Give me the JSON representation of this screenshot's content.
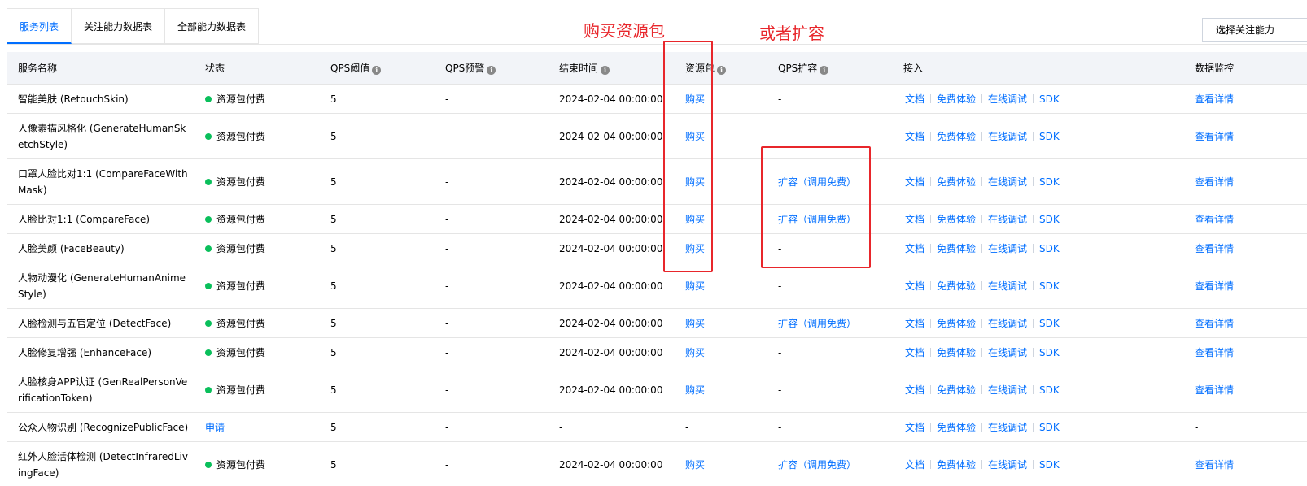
{
  "tabs": [
    {
      "label": "服务列表",
      "active": true
    },
    {
      "label": "关注能力数据表",
      "active": false
    },
    {
      "label": "全部能力数据表",
      "active": false
    }
  ],
  "select_button": "选择关注能力",
  "annotations": {
    "buy_package": "购买资源包",
    "or_expand": "或者扩容",
    "color": "#e8262b"
  },
  "colors": {
    "link": "#006eff",
    "status_green": "#0abf5b",
    "header_bg": "#f2f4f8"
  },
  "table": {
    "headers": {
      "name": "服务名称",
      "status": "状态",
      "qps_threshold": "QPS阈值",
      "qps_alert": "QPS预警",
      "end_time": "结束时间",
      "package": "资源包",
      "qps_expand": "QPS扩容",
      "access": "接入",
      "monitor": "数据监控"
    },
    "access_links": [
      "文档",
      "免费体验",
      "在线调试",
      "SDK"
    ],
    "rows": [
      {
        "name": "智能美肤 (RetouchSkin)",
        "status": "资源包付费",
        "qps": "5",
        "alert": "-",
        "end": "2024-02-04 00:00:00",
        "package": "购买",
        "expand": "-",
        "monitor": "查看详情"
      },
      {
        "name": "人像素描风格化 (GenerateHumanSketchStyle)",
        "status": "资源包付费",
        "qps": "5",
        "alert": "-",
        "end": "2024-02-04 00:00:00",
        "package": "购买",
        "expand": "-",
        "monitor": "查看详情"
      },
      {
        "name": "口罩人脸比对1:1 (CompareFaceWithMask)",
        "status": "资源包付费",
        "qps": "5",
        "alert": "-",
        "end": "2024-02-04 00:00:00",
        "package": "购买",
        "expand": "扩容（调用免费）",
        "monitor": "查看详情"
      },
      {
        "name": "人脸比对1:1 (CompareFace)",
        "status": "资源包付费",
        "qps": "5",
        "alert": "-",
        "end": "2024-02-04 00:00:00",
        "package": "购买",
        "expand": "扩容（调用免费）",
        "monitor": "查看详情"
      },
      {
        "name": "人脸美颜 (FaceBeauty)",
        "status": "资源包付费",
        "qps": "5",
        "alert": "-",
        "end": "2024-02-04 00:00:00",
        "package": "购买",
        "expand": "-",
        "monitor": "查看详情"
      },
      {
        "name": "人物动漫化 (GenerateHumanAnimeStyle)",
        "status": "资源包付费",
        "qps": "5",
        "alert": "-",
        "end": "2024-02-04 00:00:00",
        "package": "购买",
        "expand": "-",
        "monitor": "查看详情"
      },
      {
        "name": "人脸检测与五官定位 (DetectFace)",
        "status": "资源包付费",
        "qps": "5",
        "alert": "-",
        "end": "2024-02-04 00:00:00",
        "package": "购买",
        "expand": "扩容（调用免费）",
        "monitor": "查看详情"
      },
      {
        "name": "人脸修复增强 (EnhanceFace)",
        "status": "资源包付费",
        "qps": "5",
        "alert": "-",
        "end": "2024-02-04 00:00:00",
        "package": "购买",
        "expand": "-",
        "monitor": "查看详情"
      },
      {
        "name": "人脸核身APP认证 (GenRealPersonVerificationToken)",
        "status": "资源包付费",
        "qps": "5",
        "alert": "-",
        "end": "2024-02-04 00:00:00",
        "package": "购买",
        "expand": "-",
        "monitor": "查看详情"
      },
      {
        "name": "公众人物识别 (RecognizePublicFace)",
        "status": "申请",
        "qps": "5",
        "alert": "-",
        "end": "-",
        "package": "-",
        "expand": "-",
        "monitor": "-"
      },
      {
        "name": "红外人脸活体检测 (DetectInfraredLivingFace)",
        "status": "资源包付费",
        "qps": "5",
        "alert": "-",
        "end": "2024-02-04 00:00:00",
        "package": "购买",
        "expand": "扩容（调用免费）",
        "monitor": "查看详情"
      }
    ]
  }
}
